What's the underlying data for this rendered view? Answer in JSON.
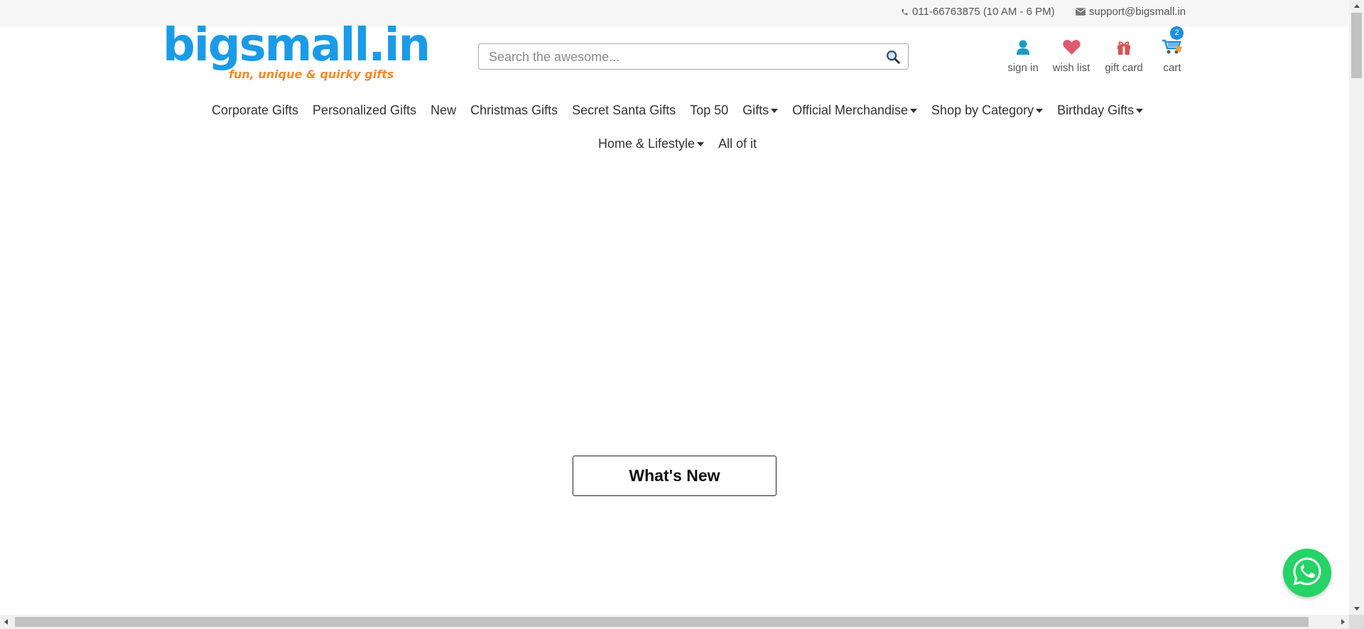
{
  "topbar": {
    "phone": "011-66763875 (10 AM - 6 PM)",
    "email": "support@bigsmall.in",
    "phone_icon": "phone-icon",
    "email_icon": "envelope-icon"
  },
  "logo": {
    "text": "bigsmall.in",
    "tagline": "fun, unique & quirky gifts",
    "color": "#1a9be8",
    "tagline_color": "#f4892a"
  },
  "search": {
    "placeholder": "Search the awesome...",
    "value": "",
    "icon": "search-icon"
  },
  "user_menu": {
    "sign_in": "sign in",
    "wish_list": "wish list",
    "gift_card": "gift card",
    "cart": "cart",
    "cart_count": "2"
  },
  "nav": {
    "items": [
      {
        "label": "Corporate Gifts",
        "dropdown": false
      },
      {
        "label": "Personalized Gifts",
        "dropdown": false
      },
      {
        "label": "New",
        "dropdown": false
      },
      {
        "label": "Christmas Gifts",
        "dropdown": false
      },
      {
        "label": "Secret Santa Gifts",
        "dropdown": false
      },
      {
        "label": "Top 50",
        "dropdown": false
      },
      {
        "label": "Gifts",
        "dropdown": true
      },
      {
        "label": "Official Merchandise",
        "dropdown": true
      },
      {
        "label": "Shop by Category",
        "dropdown": true
      },
      {
        "label": "Birthday Gifts",
        "dropdown": true
      },
      {
        "label": "Home & Lifestyle",
        "dropdown": true
      },
      {
        "label": "All of it",
        "dropdown": false
      }
    ]
  },
  "main": {
    "whats_new_button": "What's New"
  },
  "colors": {
    "accent": "#1a8fe0",
    "whatsapp": "#25d366",
    "heart": "#e05a6d",
    "gift": "#d9534f"
  }
}
